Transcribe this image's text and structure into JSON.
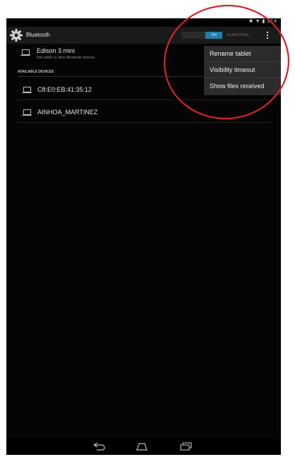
{
  "status_bar": {
    "time": "12:4",
    "icons": [
      "bluetooth-icon",
      "wifi-icon",
      "battery-icon"
    ]
  },
  "action_bar": {
    "title": "Bluetooth",
    "toggle_label": "ON",
    "searching_label": "SEARCHING..."
  },
  "paired_device": {
    "name": "Edison 3 mini",
    "subtitle": "Not visible to other Bluetooth devices"
  },
  "available_section": {
    "header": "AVAILABLE DEVICES",
    "devices": [
      {
        "name": "C8:E0:EB:41:35:12"
      },
      {
        "name": "AINHOA_MARTINEZ"
      }
    ]
  },
  "overflow_menu": {
    "items": [
      {
        "label": "Rename tablet"
      },
      {
        "label": "Visibility timeout"
      },
      {
        "label": "Show files received"
      }
    ]
  },
  "nav_bar": {
    "buttons": [
      "back-icon",
      "home-icon",
      "recent-apps-icon"
    ]
  },
  "colors": {
    "accent": "#1e7fa8",
    "annotation": "#d8202a",
    "background": "#050505"
  }
}
